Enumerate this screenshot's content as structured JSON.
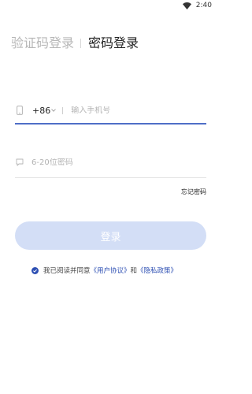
{
  "status_bar": {
    "time": "2:40",
    "wifi_icon": "wifi-icon"
  },
  "tabs": {
    "sms_login": "验证码登录",
    "password_login": "密码登录",
    "active": "password_login"
  },
  "phone": {
    "icon": "mobile-phone-icon",
    "country_code": "+86",
    "placeholder": "输入手机号",
    "value": ""
  },
  "password": {
    "icon": "comment-icon",
    "placeholder": "6-20位密码",
    "value": ""
  },
  "forgot_password": "忘记密码",
  "login_button": "登录",
  "agreement": {
    "checked": true,
    "prefix": "我已阅读并同意",
    "user_agreement": "《用户协议》",
    "conjunction": "和",
    "privacy_policy": "《隐私政策》"
  },
  "colors": {
    "accent": "#4f6fc7",
    "button_disabled": "#d3def6",
    "link": "#2d4fb3",
    "check": "#2d4fb3"
  }
}
